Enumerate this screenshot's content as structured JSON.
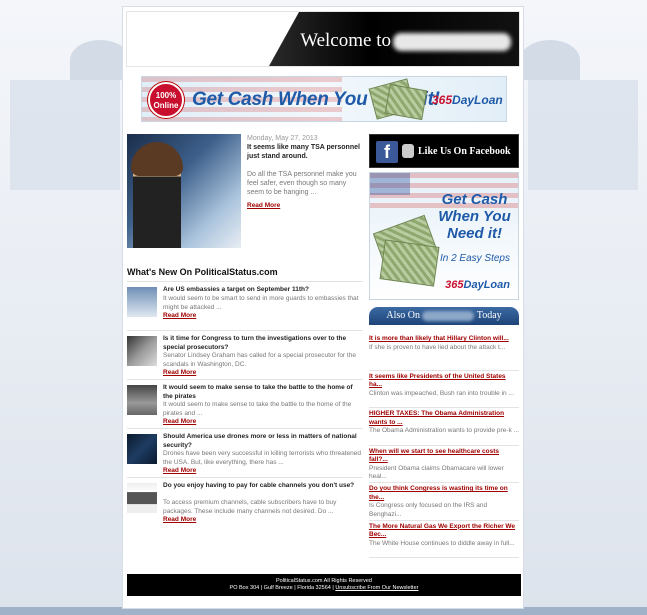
{
  "header": {
    "welcome_text": "Welcome to"
  },
  "top_banner": {
    "badge": "100% Online",
    "slogan": "Get Cash When You Need it!",
    "brand_a": "365",
    "brand_b": "DayLoan"
  },
  "featured": {
    "date": "Monday, May 27, 2013",
    "title": "It seems like many TSA personnel just stand around.",
    "excerpt": "Do all the TSA personnel make you feel safer, even though so many seem to be hanging ...",
    "read_more": "Read More"
  },
  "whats_new": {
    "title": "What's New On PoliticalStatus.com",
    "items": [
      {
        "title": "Are US embassies a target on September 11th?",
        "excerpt": "It would seem to be smart to send in more guards to embassies that might be attacked ...",
        "read_more": "Read More"
      },
      {
        "title": "Is it time for Congress to turn the investigations over to the special prosecutors?",
        "excerpt": "Senator Lindsey Graham has called for a special prosecutor for the scandals in Washington, DC.",
        "read_more": "Read More"
      },
      {
        "title": "It would seem to make sense to take the battle to the home of the pirates",
        "excerpt": "It would seem to make sense to take the battle to the home of the pirates and ...",
        "read_more": "Read More"
      },
      {
        "title": "Should America use drones more or less in matters of national security?",
        "excerpt": "Drones have been very successful in killing terrorists who threatened the USA. But, like everything, there has ...",
        "read_more": "Read More"
      },
      {
        "title": "Do you enjoy having to pay for cable channels you don't use?",
        "excerpt": "To access premium channels, cable subscribers have to buy packages. These include many channels not desired. Do ...",
        "read_more": "Read More"
      }
    ]
  },
  "facebook": {
    "label": "Like Us On Facebook"
  },
  "side_ad": {
    "headline": "Get Cash When You Need it!",
    "steps": "In 2 Easy Steps",
    "brand_a": "365",
    "brand_b": "DayLoan"
  },
  "also_on": {
    "prefix": "Also On",
    "suffix": "Today",
    "items": [
      {
        "title": "It is more than likely that Hillary Clinton will...",
        "excerpt": "If she is proven to have lied about the attack t..."
      },
      {
        "title": "It seems like Presidents of the United States ha...",
        "excerpt": "Clinton was impeached, Bush ran into trouble in ..."
      },
      {
        "title": "HIGHER TAXES: The Obama Administration wants to ...",
        "excerpt": "The Obama Administration wants to provide pre-k ..."
      },
      {
        "title": "When will we start to see healthcare costs fall?...",
        "excerpt": "President Obama claims Obamacare will lower heal..."
      },
      {
        "title": "Do you think Congress is wasting its time on the...",
        "excerpt": "Is Congress only focused on the IRS and Benghazi..."
      },
      {
        "title": "The More Natural Gas We Export the Richer We Bec...",
        "excerpt": "The White House continues to diddle away in full..."
      }
    ]
  },
  "footer": {
    "line1": "PoliticalStatus.com All Rights Reserved",
    "line2": "PO Box 304 | Gulf Breeze | Florida 32564 |",
    "unsubscribe": "Unsubscribe From Our Newsletter"
  }
}
